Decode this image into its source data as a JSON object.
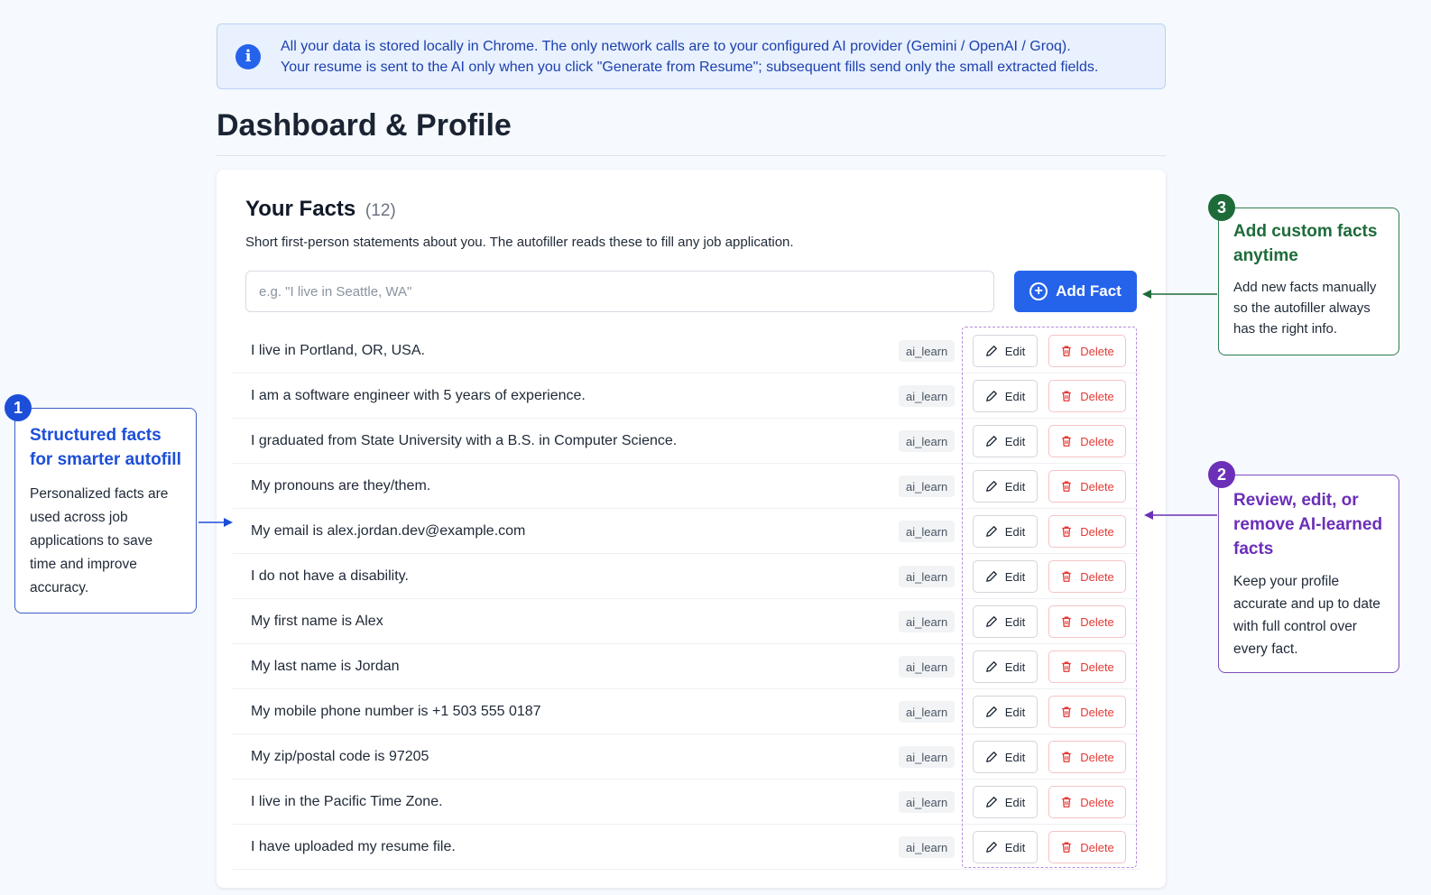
{
  "banner": {
    "line1": "All your data is stored locally in Chrome. The only network calls are to your configured AI provider (Gemini / OpenAI / Groq).",
    "line2": "Your resume is sent to the AI only when you click \"Generate from Resume\"; subsequent fills send only the small extracted fields.",
    "icon": "info-icon"
  },
  "page_title": "Dashboard & Profile",
  "facts_card": {
    "title": "Your Facts",
    "count": "(12)",
    "description": "Short first-person statements about you. The autofiller reads these to fill any job application.",
    "input_placeholder": "e.g. \"I live in Seattle, WA\"",
    "add_button": "Add Fact",
    "edit_label": "Edit",
    "delete_label": "Delete",
    "facts": [
      {
        "text": "I live in Portland, OR, USA.",
        "source": "ai_learn"
      },
      {
        "text": "I am a software engineer with 5 years of experience.",
        "source": "ai_learn"
      },
      {
        "text": "I graduated from State University with a B.S. in Computer Science.",
        "source": "ai_learn"
      },
      {
        "text": "My pronouns are they/them.",
        "source": "ai_learn"
      },
      {
        "text": "My email is alex.jordan.dev@example.com",
        "source": "ai_learn"
      },
      {
        "text": "I do not have a disability.",
        "source": "ai_learn"
      },
      {
        "text": "My first name is Alex",
        "source": "ai_learn"
      },
      {
        "text": "My last name is Jordan",
        "source": "ai_learn"
      },
      {
        "text": "My mobile phone number is +1 503 555 0187",
        "source": "ai_learn"
      },
      {
        "text": "My zip/postal code is 97205",
        "source": "ai_learn"
      },
      {
        "text": "I live in the Pacific Time Zone.",
        "source": "ai_learn"
      },
      {
        "text": "I have uploaded my resume file.",
        "source": "ai_learn"
      }
    ]
  },
  "callouts": {
    "one": {
      "number": "1",
      "title": "Structured facts for smarter autofill",
      "body": "Personalized facts are used across job applications to save time and improve accuracy."
    },
    "two": {
      "number": "2",
      "title": "Review, edit, or remove AI-learned facts",
      "body": "Keep your profile accurate and up to date with full control over every fact."
    },
    "three": {
      "number": "3",
      "title": "Add custom facts anytime",
      "body": "Add new facts manually so the autofiller always has the right info."
    }
  },
  "colors": {
    "primary": "#2563eb",
    "danger": "#e53935",
    "callout_blue": "#1d4ed8",
    "callout_purple": "#6b2fb8",
    "callout_green": "#1e6b3a"
  }
}
